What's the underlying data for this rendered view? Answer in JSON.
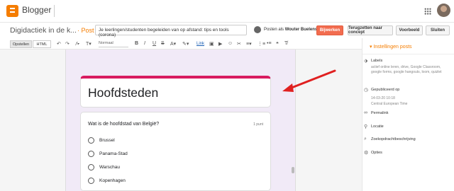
{
  "app": {
    "name": "Blogger"
  },
  "postbar": {
    "blog_name": "Digidactiek in de k...",
    "post_sep": "· Post",
    "title": "Je leerlingen/studenten begeleiden van op afstand: tips en tools (corona)",
    "author_prefix": "Posten als",
    "author_name": "Wouter Buelens",
    "publish": "Bijwerken",
    "draft": "Terugzetten naar concept",
    "preview": "Voorbeeld",
    "close": "Sluiten"
  },
  "toolbar": {
    "compose": "Opstellen",
    "html": "HTML",
    "font": "Normaal",
    "link": "Link"
  },
  "form": {
    "title": "Hoofdsteden",
    "question": "Wat is de hoofdstad van België?",
    "points": "1 punt",
    "options": [
      "Brussel",
      "Panama-Stad",
      "Warschau",
      "Kopenhagen"
    ]
  },
  "sidebar": {
    "header": "▾ Instellingen posts",
    "labels_title": "Labels",
    "labels_value": "actief online leren, drive, Google Classroom, google forms, google hangouts, loom, quizlet",
    "published_title": "Gepubliceerd op",
    "published_value": "14-03-20 10:18",
    "timezone": "Central European Time",
    "permalink": "Permalink",
    "location": "Locatie",
    "search_desc": "Zoekopdrachtbeschrijving",
    "options": "Opties"
  },
  "colors": {
    "accent": "#f57d00",
    "form_accent": "#d81b60",
    "arrow": "#e02020"
  }
}
